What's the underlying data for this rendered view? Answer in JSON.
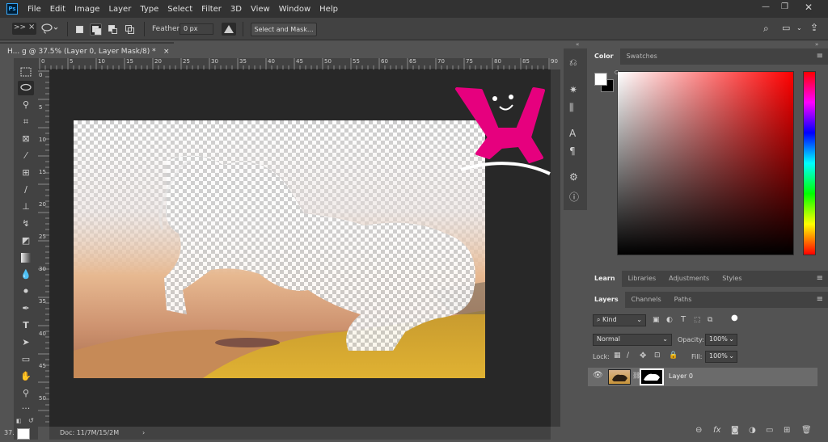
{
  "app": {
    "logo": "Ps"
  },
  "menu": [
    "File",
    "Edit",
    "Image",
    "Layer",
    "Type",
    "Select",
    "Filter",
    "3D",
    "View",
    "Window",
    "Help"
  ],
  "options": {
    "feather_label": "Feather:",
    "feather_value": "0 px",
    "select_mask": "Select and Mask..."
  },
  "doc_tab": {
    "title": "H... g @ 37.5% (Layer 0, Layer Mask/8) *",
    "close": "×"
  },
  "ruler_top": [
    "0",
    "5",
    "10",
    "15",
    "20",
    "25",
    "30",
    "35",
    "40",
    "45",
    "50",
    "55",
    "60",
    "65",
    "70",
    "75",
    "80",
    "85",
    "90"
  ],
  "ruler_left": [
    "0",
    "5",
    "10",
    "15",
    "20",
    "25",
    "30",
    "35",
    "40",
    "45",
    "50"
  ],
  "status": {
    "zoom": "37.",
    "doc": "Doc: 11/7M/15/2M"
  },
  "color_panel": {
    "tabs": [
      "Color",
      "Swatches"
    ],
    "fg": "#ffffff",
    "bg": "#000000",
    "hue": "#ff0000"
  },
  "learn_panel": {
    "tabs": [
      "Learn",
      "Libraries",
      "Adjustments",
      "Styles"
    ]
  },
  "layers_panel": {
    "tabs": [
      "Layers",
      "Channels",
      "Paths"
    ],
    "filter": "Kind",
    "blend": "Normal",
    "opacity_label": "Opacity:",
    "opacity": "100%",
    "lock_label": "Lock:",
    "fill_label": "Fill:",
    "fill": "100%",
    "layer_name": "Layer 0"
  },
  "watermark_color": "#e6007e"
}
